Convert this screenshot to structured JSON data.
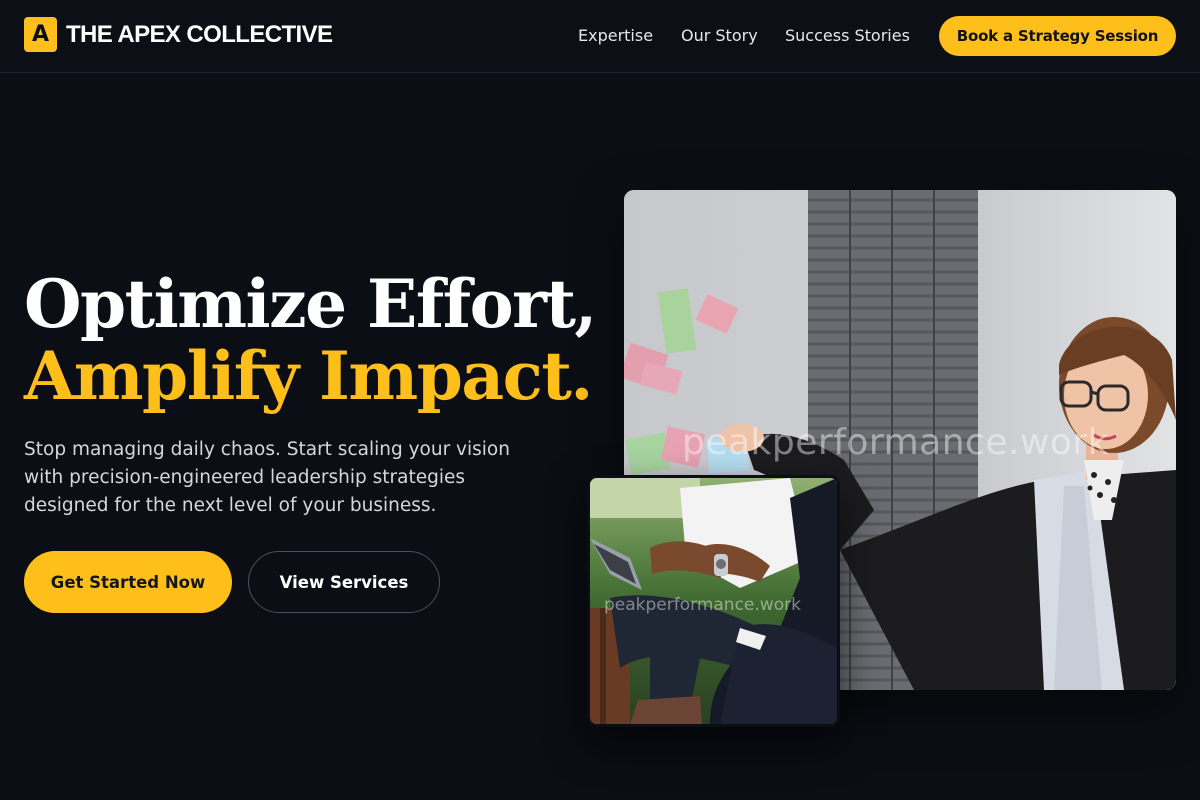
{
  "brand": {
    "logo_letter": "A",
    "name": "THE APEX COLLECTIVE",
    "accent_color": "#ffbf1a",
    "background_color": "#0b0e14"
  },
  "nav": {
    "items": [
      {
        "label": "Expertise"
      },
      {
        "label": "Our Story"
      },
      {
        "label": "Success Stories"
      }
    ],
    "cta_label": "Book a Strategy Session"
  },
  "hero": {
    "headline_line1": "Optimize Effort,",
    "headline_line2": "Amplify Impact.",
    "subtext": "Stop managing daily chaos. Start scaling your vision with precision-engineered leadership strategies designed for the next level of your business.",
    "primary_button": "Get Started Now",
    "secondary_button": "View Services"
  },
  "images": {
    "main_photo_watermark": "peakperformance.work",
    "small_photo_watermark": "peakperformance.work"
  }
}
